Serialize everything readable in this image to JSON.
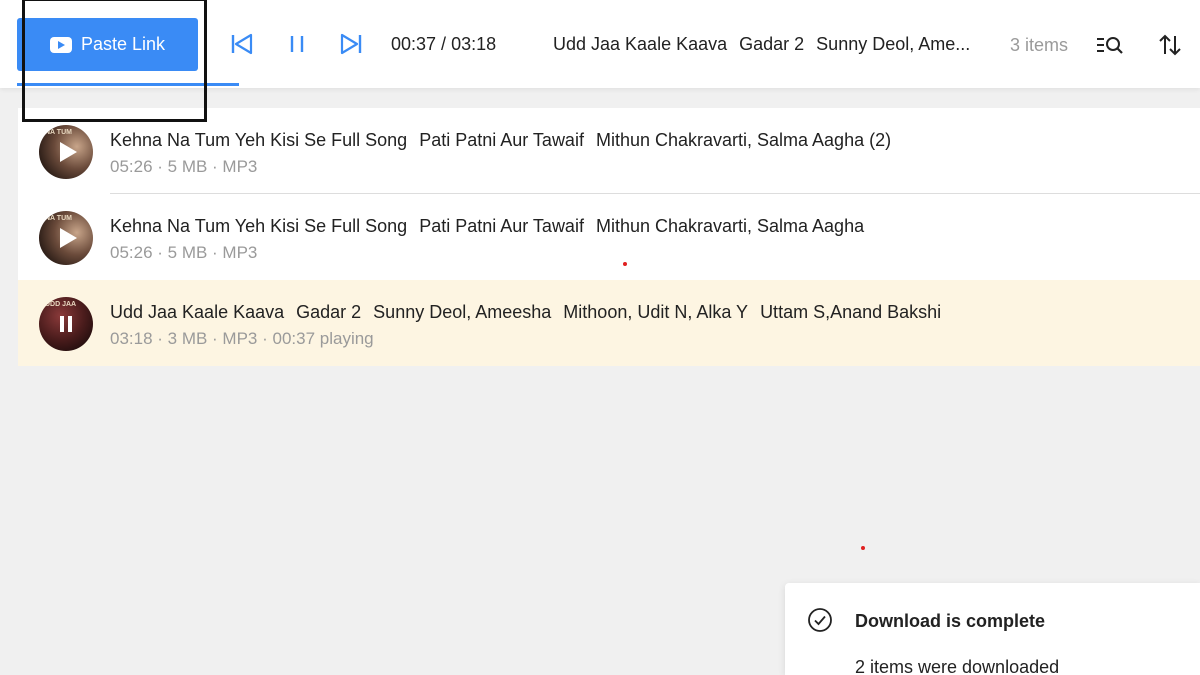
{
  "toolbar": {
    "paste_link_label": "Paste Link",
    "time_current": "00:37",
    "time_total": "03:18",
    "time_separator": " / ",
    "now_playing": {
      "title": "Udd Jaa Kaale Kaava",
      "album": "Gadar 2",
      "artists": "Sunny Deol, Ame..."
    },
    "item_count": "3 items",
    "icons": {
      "paste": "youtube-icon",
      "previous": "skip-previous-icon",
      "pause": "pause-icon",
      "next": "skip-next-icon",
      "search_list": "search-list-icon",
      "sort": "sort-icon"
    },
    "accent_color": "#3a8bf5"
  },
  "tracks": [
    {
      "title": "Kehna Na Tum Yeh Kisi Se Full Song",
      "album": "Pati Patni Aur Tawaif",
      "artists": "Mithun Chakravarti, Salma Aagha (2)",
      "meta": "05:26 · 5 MB · MP3",
      "state": "paused",
      "state_icon": "play-icon"
    },
    {
      "title": "Kehna Na Tum Yeh Kisi Se Full Song",
      "album": "Pati Patni Aur Tawaif",
      "artists": "Mithun Chakravarti, Salma Aagha",
      "meta": "05:26 · 5 MB · MP3",
      "state": "paused",
      "state_icon": "play-icon"
    },
    {
      "title": "Udd Jaa Kaale Kaava",
      "album": "Gadar 2",
      "artists": "Sunny Deol, Ameesha",
      "composers": "Mithoon, Udit N, Alka Y",
      "lyricists": "Uttam S,Anand Bakshi",
      "meta": "03:18 · 3 MB · MP3 · 00:37 playing",
      "state": "playing",
      "state_icon": "pause-icon",
      "highlight_color": "#fdf5e2"
    }
  ],
  "toast": {
    "title": "Download is complete",
    "body": "2 items were downloaded",
    "icon": "check-circle-icon"
  }
}
